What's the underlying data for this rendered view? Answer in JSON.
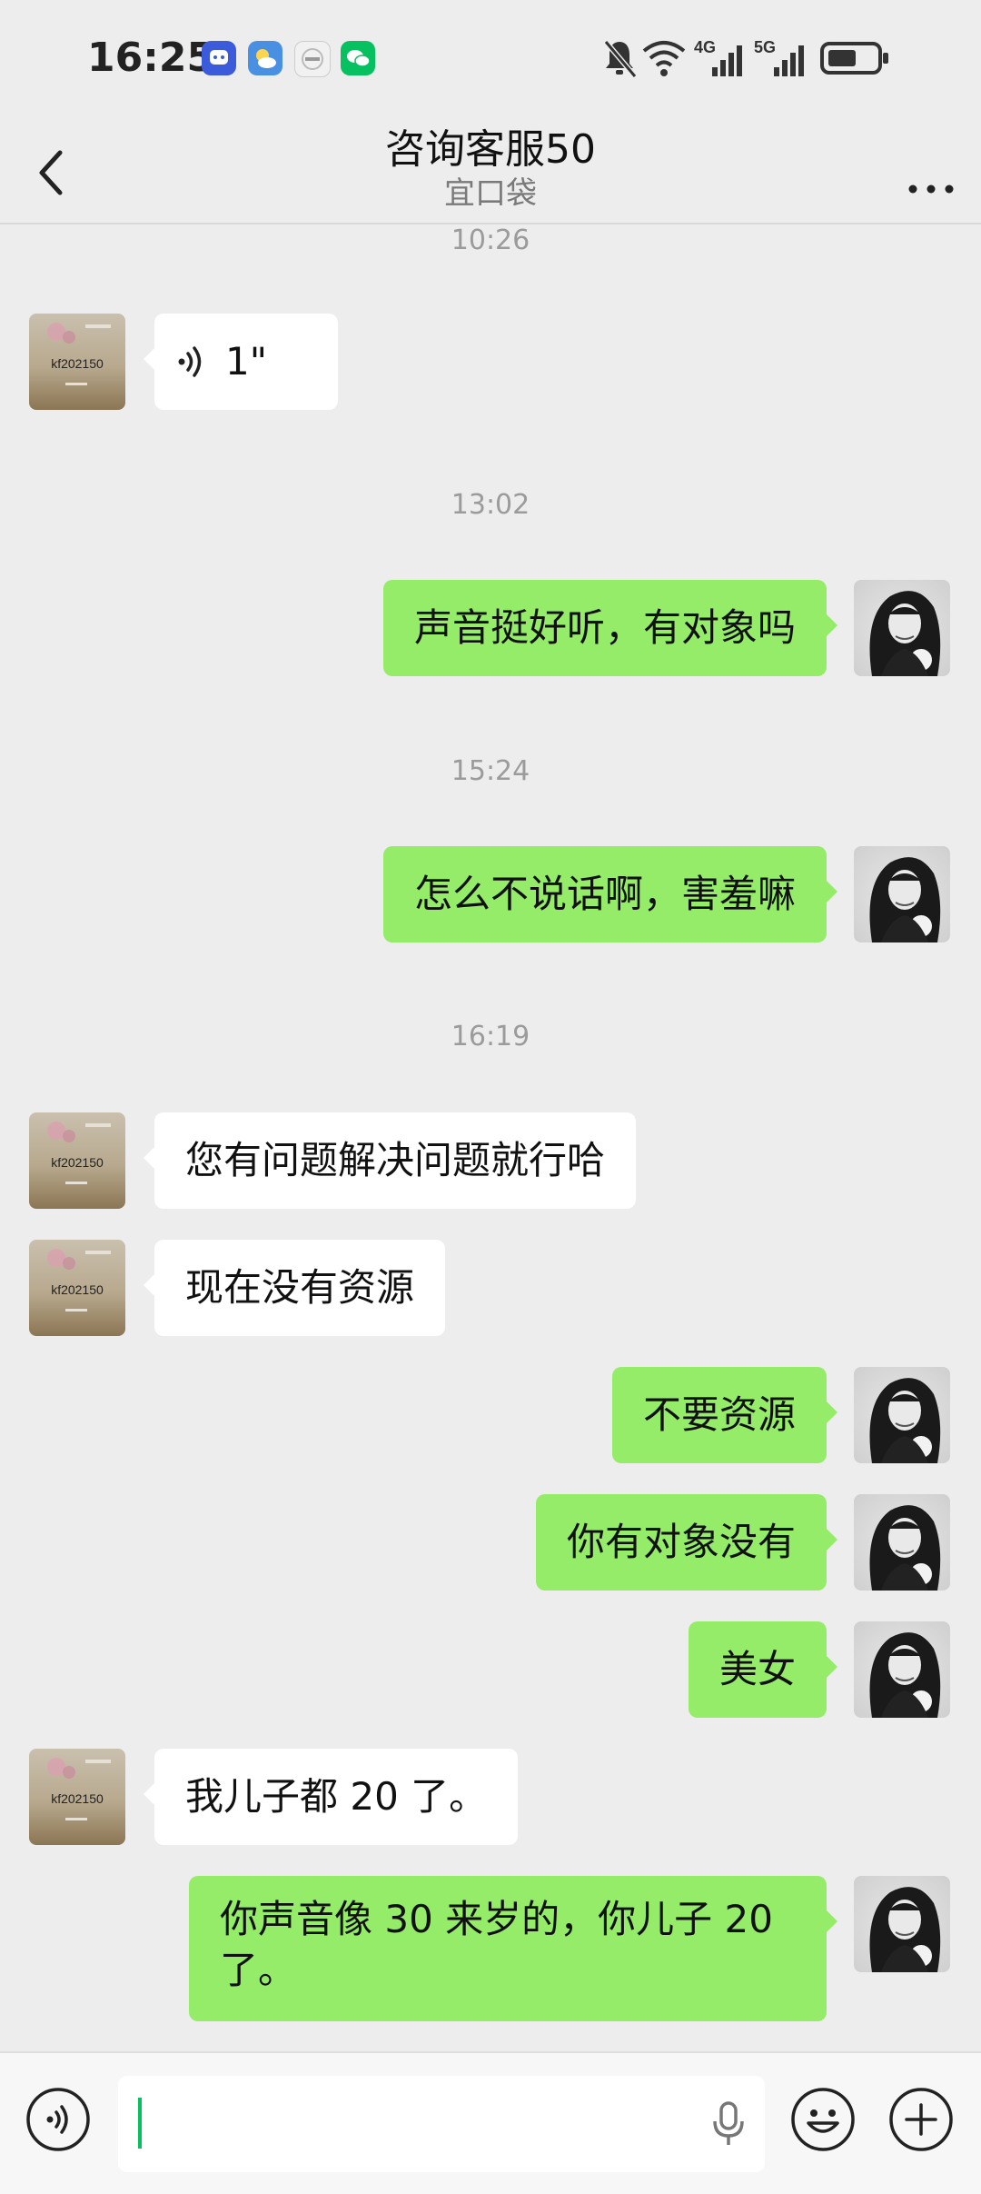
{
  "status_bar": {
    "time": "16:25",
    "network": [
      "4G",
      "5G"
    ]
  },
  "header": {
    "title": "咨询客服50",
    "subtitle": "宜口袋"
  },
  "avatars": {
    "agent_label": "kf202150"
  },
  "timestamps": [
    "10:26",
    "13:02",
    "15:24",
    "16:19"
  ],
  "messages": [
    {
      "from": "agent",
      "type": "voice",
      "text": "1\""
    },
    {
      "from": "me",
      "text": "声音挺好听，有对象吗"
    },
    {
      "from": "me",
      "text": "怎么不说话啊，害羞嘛"
    },
    {
      "from": "agent",
      "text": "您有问题解决问题就行哈"
    },
    {
      "from": "agent",
      "text": "现在没有资源"
    },
    {
      "from": "me",
      "text": "不要资源"
    },
    {
      "from": "me",
      "text": "你有对象没有"
    },
    {
      "from": "me",
      "text": "美女"
    },
    {
      "from": "agent",
      "text": "我儿子都 20 了。"
    },
    {
      "from": "me",
      "text": "你声音像 30 来岁的，你儿子 20 了。"
    }
  ],
  "input": {
    "value": ""
  },
  "colors": {
    "background": "#ededed",
    "my_bubble": "#95ec69",
    "agent_bubble": "#ffffff",
    "caret": "#07c160"
  }
}
